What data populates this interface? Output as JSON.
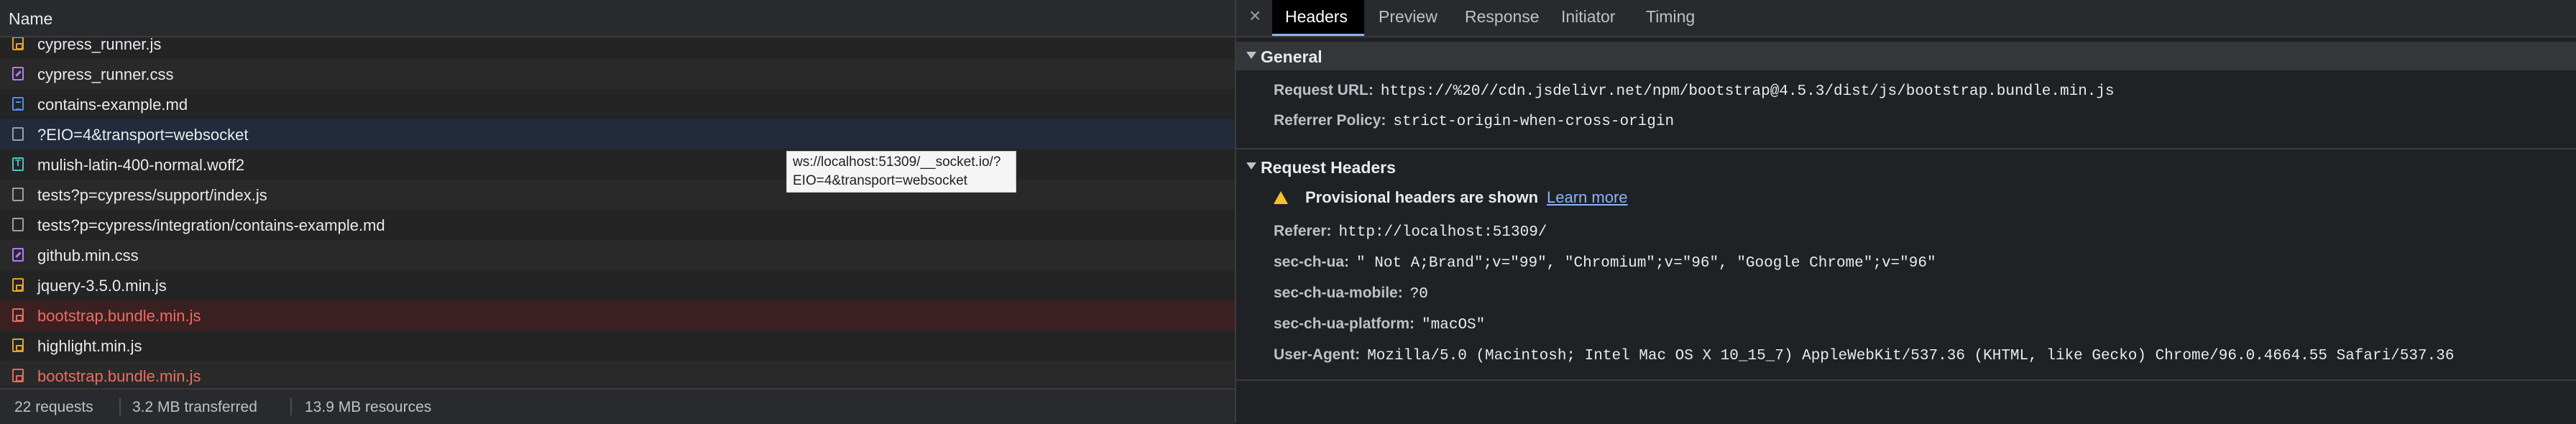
{
  "network": {
    "name_header": "Name",
    "rows": [
      {
        "label": "cypress_runner.js",
        "icon": "js-file-icon"
      },
      {
        "label": "cypress_runner.css",
        "icon": "css-file-icon"
      },
      {
        "label": "contains-example.md",
        "icon": "document-file-icon"
      },
      {
        "label": "?EIO=4&transport=websocket",
        "icon": "websocket-icon"
      },
      {
        "label": "mulish-latin-400-normal.woff2",
        "icon": "font-file-icon"
      },
      {
        "label": "tests?p=cypress/support/index.js",
        "icon": "document-icon"
      },
      {
        "label": "tests?p=cypress/integration/contains-example.md",
        "icon": "document-icon"
      },
      {
        "label": "github.min.css",
        "icon": "css-file-icon"
      },
      {
        "label": "jquery-3.5.0.min.js",
        "icon": "js-file-icon"
      },
      {
        "label": "bootstrap.bundle.min.js",
        "icon": "js-file-error-icon"
      },
      {
        "label": "highlight.min.js",
        "icon": "js-file-icon"
      },
      {
        "label": "bootstrap.bundle.min.js",
        "icon": "js-file-error-icon"
      }
    ],
    "tooltip_line1": "ws://localhost:51309/__socket.io/?",
    "tooltip_line2": "EIO=4&transport=websocket",
    "status": {
      "requests": "22 requests",
      "transferred": "3.2 MB transferred",
      "resources": "13.9 MB resources"
    },
    "colors": {
      "error_text": "#ee6c5f",
      "selected_row": "#212b3c",
      "error_row": "#3b2022"
    }
  },
  "details": {
    "close_icon": "×",
    "tabs": [
      "Headers",
      "Preview",
      "Response",
      "Initiator",
      "Timing"
    ],
    "active_tab": "Headers",
    "general": {
      "title": "General",
      "request_url_key": "Request URL:",
      "request_url_val": "https://%20//cdn.jsdelivr.net/npm/bootstrap@4.5.3/dist/js/bootstrap.bundle.min.js",
      "referrer_policy_key": "Referrer Policy:",
      "referrer_policy_val": "strict-origin-when-cross-origin"
    },
    "request_headers": {
      "title": "Request Headers",
      "warning": "Provisional headers are shown",
      "learn_more": "Learn more",
      "referer_key": "Referer:",
      "referer_val": "http://localhost:51309/",
      "sec_ch_ua_key": "sec-ch-ua:",
      "sec_ch_ua_val": "\" Not A;Brand\";v=\"99\", \"Chromium\";v=\"96\", \"Google Chrome\";v=\"96\"",
      "sec_ch_ua_mobile_key": "sec-ch-ua-mobile:",
      "sec_ch_ua_mobile_val": "?0",
      "sec_ch_ua_platform_key": "sec-ch-ua-platform:",
      "sec_ch_ua_platform_val": "\"macOS\"",
      "user_agent_key": "User-Agent:",
      "user_agent_val": "Mozilla/5.0 (Macintosh; Intel Mac OS X 10_15_7) AppleWebKit/537.36 (KHTML, like Gecko) Chrome/96.0.4664.55 Safari/537.36"
    }
  }
}
